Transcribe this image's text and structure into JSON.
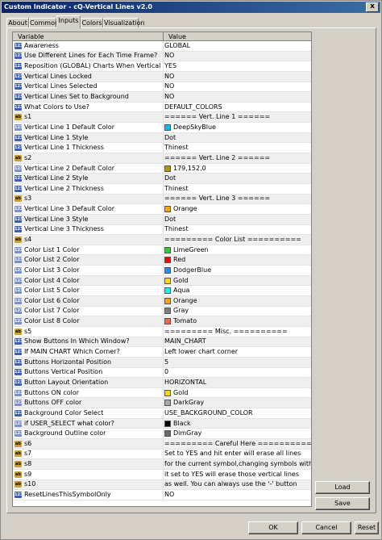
{
  "window": {
    "title": "Custom Indicator - cQ-Vertical Lines v2.0",
    "close_glyph": "x"
  },
  "tabs": [
    "About",
    "Common",
    "Inputs",
    "Colors",
    "Visualization"
  ],
  "grid": {
    "header_variable": "Variable",
    "header_value": "Value",
    "rows": [
      {
        "icon": "enum",
        "name": "Awareness",
        "value": "GLOBAL"
      },
      {
        "icon": "enum",
        "name": "Use Different Lines for Each Time Frame?",
        "value": "NO"
      },
      {
        "icon": "enum",
        "name": "Reposition (GLOBAL) Charts When Vertical Line Moved",
        "value": "YES"
      },
      {
        "icon": "enum",
        "name": "Vertical Lines Locked",
        "value": "NO"
      },
      {
        "icon": "enum",
        "name": "Vertical Lines Selected",
        "value": "NO"
      },
      {
        "icon": "enum",
        "name": "Vertical Lines Set to Background",
        "value": "NO"
      },
      {
        "icon": "enum",
        "name": "What Colors to Use?",
        "value": "DEFAULT_COLORS"
      },
      {
        "icon": "str",
        "name": "s1",
        "value": "====== Vert. Line 1 ======"
      },
      {
        "icon": "col",
        "name": "Vertical Line 1 Default Color",
        "value": "DeepSkyBlue",
        "swatch": "#00bfff"
      },
      {
        "icon": "enum",
        "name": "Vertical Line 1 Style",
        "value": "Dot"
      },
      {
        "icon": "enum",
        "name": "Vertical Line 1 Thickness",
        "value": "Thinest"
      },
      {
        "icon": "str",
        "name": "s2",
        "value": "====== Vert. Line 2 ======"
      },
      {
        "icon": "col",
        "name": "Vertical Line 2 Default Color",
        "value": "179,152,0",
        "swatch": "#b39800"
      },
      {
        "icon": "enum",
        "name": "Vertical Line 2 Style",
        "value": "Dot"
      },
      {
        "icon": "enum",
        "name": "Vertical Line 2 Thickness",
        "value": "Thinest"
      },
      {
        "icon": "str",
        "name": "s3",
        "value": "====== Vert. Line 3 ======"
      },
      {
        "icon": "col",
        "name": "Vertical Line 3 Default Color",
        "value": "Orange",
        "swatch": "#ffa500"
      },
      {
        "icon": "enum",
        "name": "Vertical Line 3 Style",
        "value": "Dot"
      },
      {
        "icon": "enum",
        "name": "Vertical Line 3 Thickness",
        "value": "Thinest"
      },
      {
        "icon": "str",
        "name": "s4",
        "value": "========= Color List =========="
      },
      {
        "icon": "col",
        "name": "Color List 1 Color",
        "value": "LimeGreen",
        "swatch": "#32cd32"
      },
      {
        "icon": "col",
        "name": "Color List 2 Color",
        "value": "Red",
        "swatch": "#ff0000"
      },
      {
        "icon": "col",
        "name": "Color List 3 Color",
        "value": "DodgerBlue",
        "swatch": "#1e90ff"
      },
      {
        "icon": "col",
        "name": "Color List 4 Color",
        "value": "Gold",
        "swatch": "#ffd700"
      },
      {
        "icon": "col",
        "name": "Color List 5 Color",
        "value": "Aqua",
        "swatch": "#00ffff"
      },
      {
        "icon": "col",
        "name": "Color List 6 Color",
        "value": "Orange",
        "swatch": "#ffa500"
      },
      {
        "icon": "col",
        "name": "Color List 7 Color",
        "value": "Gray",
        "swatch": "#808080"
      },
      {
        "icon": "col",
        "name": "Color List 8 Color",
        "value": "Tomato",
        "swatch": "#ff6347"
      },
      {
        "icon": "str",
        "name": "s5",
        "value": "========= Misc. =========="
      },
      {
        "icon": "enum",
        "name": "Show Buttons In Which Window?",
        "value": "MAIN_CHART"
      },
      {
        "icon": "enum",
        "name": "If MAIN CHART Which Corner?",
        "value": "Left lower chart corner"
      },
      {
        "icon": "num",
        "name": "Buttons Horizontal Position",
        "value": "5"
      },
      {
        "icon": "num",
        "name": "Buttons Vertical Position",
        "value": "0"
      },
      {
        "icon": "enum",
        "name": "Button Layout Orientation",
        "value": "HORIZONTAL"
      },
      {
        "icon": "col",
        "name": "Buttons ON color",
        "value": "Gold",
        "swatch": "#ffd700"
      },
      {
        "icon": "col",
        "name": "Buttons OFF color",
        "value": "DarkGray",
        "swatch": "#a9a9a9"
      },
      {
        "icon": "enum",
        "name": "Background Color Select",
        "value": "USE_BACKGROUND_COLOR"
      },
      {
        "icon": "col",
        "name": "if USER_SELECT what color?",
        "value": "Black",
        "swatch": "#000000"
      },
      {
        "icon": "col",
        "name": "Background Outline color",
        "value": "DimGray",
        "swatch": "#696969"
      },
      {
        "icon": "str",
        "name": "s6",
        "value": "========= Careful Here =========="
      },
      {
        "icon": "str",
        "name": "s7",
        "value": "Set to YES and hit enter will erase all lines"
      },
      {
        "icon": "str",
        "name": "s8",
        "value": "for the current symbol,changing symbols with"
      },
      {
        "icon": "str",
        "name": "s9",
        "value": "it set to YES will erase those vertical lines"
      },
      {
        "icon": "str",
        "name": "s10",
        "value": "as well.  You can always use the '-' button"
      },
      {
        "icon": "enum",
        "name": "ResetLinesThisSymbolOnly",
        "value": "NO"
      }
    ]
  },
  "buttons": {
    "load": "Load",
    "save": "Save",
    "ok": "OK",
    "cancel": "Cancel",
    "reset": "Reset"
  },
  "icon_glyphs": {
    "num": "123",
    "enum": "123",
    "str": "ab",
    "col": "123"
  }
}
